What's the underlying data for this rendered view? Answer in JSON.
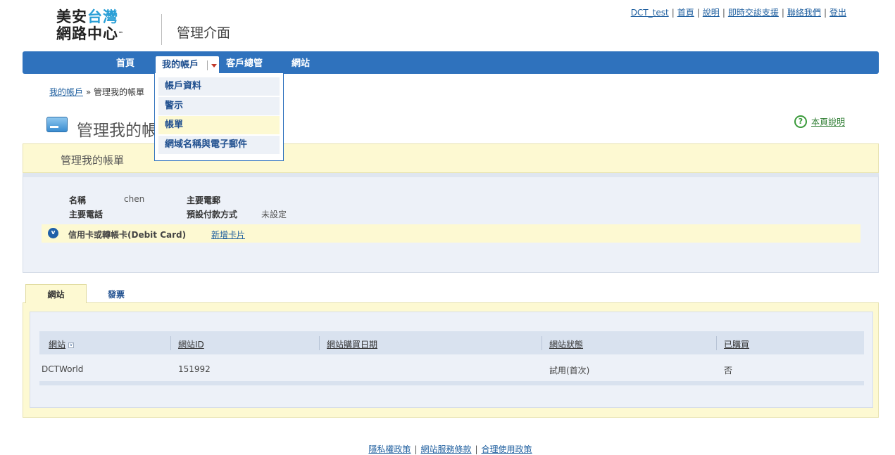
{
  "logo": {
    "line1_black": "美安",
    "line1_blue": "台灣",
    "line2": "網路中心",
    "tm": "™"
  },
  "header": {
    "subtitle": "管理介面"
  },
  "top_links": [
    "DCT_test",
    "首頁",
    "說明",
    "即時交談支援",
    "聯絡我們",
    "登出"
  ],
  "top_links_separator": "|",
  "nav": {
    "home": "首頁",
    "account": "我的帳戶",
    "clients": "客戶總管",
    "sites": "網站"
  },
  "dropdown": [
    "帳戶資料",
    "警示",
    "帳單",
    "網域名稱與電子郵件"
  ],
  "breadcrumb": {
    "link": "我的帳戶",
    "sep": "»",
    "current": "管理我的帳單"
  },
  "page_title": "管理我的帳單",
  "help": {
    "icon_glyph": "?",
    "label": "本頁說明"
  },
  "section_header": "管理我的帳單",
  "info": {
    "name_label": "名稱",
    "name_value": "chen",
    "phone_label": "主要電話",
    "phone_value": "",
    "email_label": "主要電郵",
    "email_value": "",
    "payment_label": "預設付款方式",
    "payment_value": "未設定"
  },
  "card": {
    "icon_glyph": "v",
    "label": "信用卡或轉帳卡(Debit Card)",
    "add_link": "新增卡片"
  },
  "tabs": {
    "sites": "網站",
    "invoices": "發票"
  },
  "table": {
    "headers": [
      "網站",
      "網站ID",
      "網站購買日期",
      "網站狀態",
      "已購買"
    ],
    "sort_glyph": "v",
    "rows": [
      {
        "site": "DCTWorld",
        "id": "151992",
        "date": "",
        "status": "試用(首次)",
        "purchased": "否"
      }
    ]
  },
  "footer": {
    "links": [
      "隱私權政策",
      "網站服務條款",
      "合理使用政策"
    ],
    "separator": "|"
  },
  "colors": {
    "nav": "#2f72bd",
    "highlight": "#fdf9d2",
    "panel": "#edf1f8",
    "link": "#1f5f9f"
  }
}
